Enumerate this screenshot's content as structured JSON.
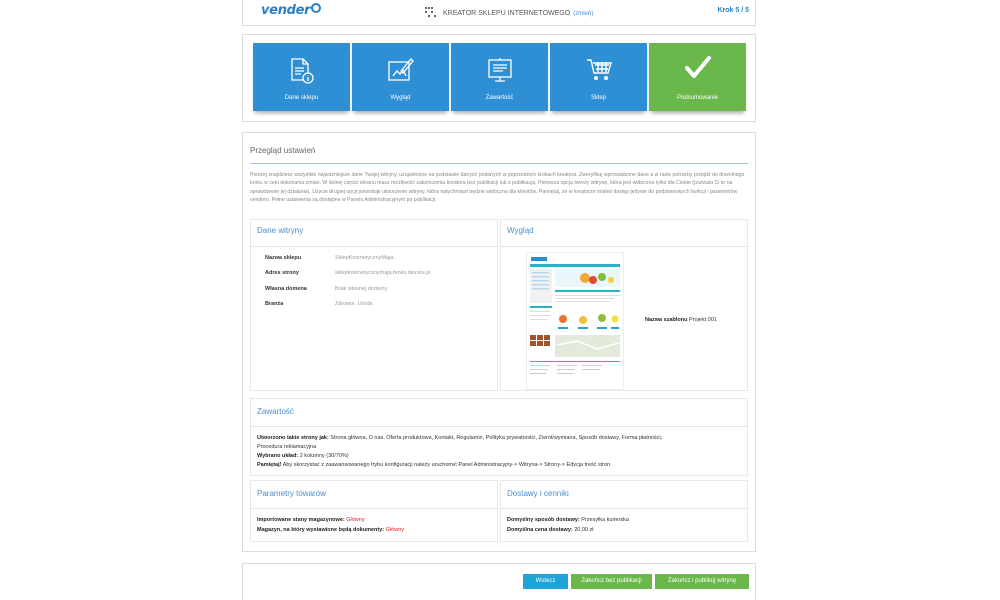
{
  "header": {
    "logo_text": "vender",
    "wizard_title": "KREATOR SKLEPU INTERNETOWEGO",
    "change_link": "(zmień)",
    "step_indicator": "Krok 5 / 5"
  },
  "steps": [
    {
      "label": "Dane sklepu",
      "icon": "document-info-icon"
    },
    {
      "label": "Wygląd",
      "icon": "design-brush-icon"
    },
    {
      "label": "Zawartość",
      "icon": "content-board-icon"
    },
    {
      "label": "Sklep",
      "icon": "cart-icon"
    },
    {
      "label": "Podsumowanie",
      "icon": "checkmark-icon",
      "active": true
    }
  ],
  "summary": {
    "title": "Przegląd ustawień",
    "intro": "Poniżej znajdziesz wszystkie najważniejsze dane Twojej witryny, uzupełnione na podstawie danych podanych w poprzednich krokach kreatora. Zweryfikuj wprowadzone dane a w razie potrzeby przejdź do dowolnego kroku w celu dokonania zmian. W dolnej części ekranu masz możliwość zakończenia kreatora bez publikacji lub z publikacją. Pierwsza opcja tworzy witrynę, która jest widoczna tylko dla Ciebie (pozwala Ci to na sprawdzenie jej działania). Użycie drugiej opcji powoduje utworzenie witryny, która natychmiast będzie widoczna dla klientów. Pamiętaj, że w kreatorze miałeś dostęp jedynie do podstawowych funkcji i parametrów vendero. Pełne ustawienia są dostępne w Panelu Administracyjnym po publikacji."
  },
  "site_data": {
    "title": "Dane witryny",
    "rows": [
      {
        "key": "Nazwa sklepu",
        "value": "SklepKosmetycznyMaja"
      },
      {
        "key": "Adres strony",
        "value": "sklepkosmetycznymaja.fenks.dev.ins.pl"
      },
      {
        "key": "Własna domena",
        "value": "Brak własnej domeny"
      },
      {
        "key": "Branża",
        "value": "Zdrowie, Uroda"
      }
    ]
  },
  "appearance": {
    "title": "Wygląd",
    "template_key": "Nazwa szablonu",
    "template_value": "Projekt 001"
  },
  "content": {
    "title": "Zawartość",
    "pages_key": "Utworzono takie strony jak:",
    "pages_value": "Strona główna, O nas, Oferta produktowa, Kontakt, Regulamin, Polityka prywatności, Zwrot/wymiana, Sposób dostawy, Forma płatności,",
    "pages_value_2": "Procedura reklamacyjna",
    "layout_key": "Wybrano układ:",
    "layout_value": "2 kolumny (30/70%)",
    "remember_key": "Pamiętaj!",
    "remember_value": "Aby skorzystać z zaawansowanego trybu konfiguracji należy uruchomić Panel Administracyjny-> Witryna-> Strony-> Edycja treść stron."
  },
  "products": {
    "title": "Parametry towarów",
    "rows": [
      {
        "key": "Importowane stany magazynowe:",
        "value": "Główny"
      },
      {
        "key": "Magazyn, na który wystawione będą dokumenty:",
        "value": "Główny"
      }
    ]
  },
  "delivery": {
    "title": "Dostawy i cenniki",
    "rows": [
      {
        "key": "Domyślny sposób dostawy:",
        "value": "Przesyłka kurierska"
      },
      {
        "key": "Domyślna cena dostawy:",
        "value": "20,00 zł"
      }
    ]
  },
  "footer": {
    "back_label": "Wstecz",
    "finish_no_publish_label": "Zakończ bez publikacji",
    "finish_publish_label": "Zakończ i publikuj witrynę"
  },
  "colors": {
    "step_blue": "#2f8fd4",
    "step_active_green": "#6ab84b",
    "button_blue": "#1ea4d8",
    "accent_red": "#e02020"
  }
}
